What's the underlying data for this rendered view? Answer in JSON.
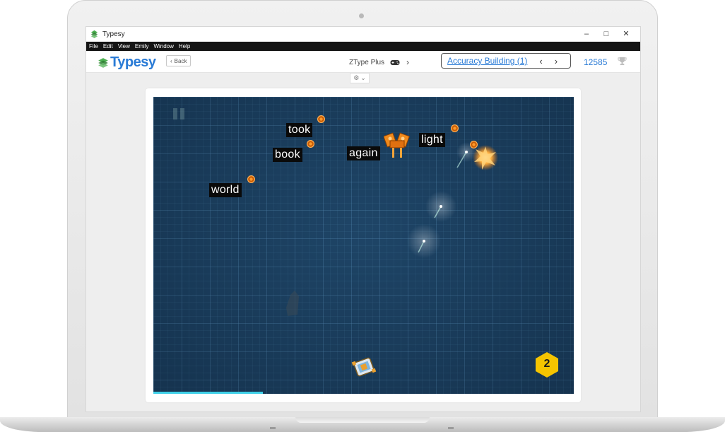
{
  "window": {
    "title": "Typesy",
    "controls": {
      "minimize": "–",
      "maximize": "□",
      "close": "✕"
    }
  },
  "menu": [
    "File",
    "Edit",
    "View",
    "Emily",
    "Window",
    "Help"
  ],
  "toolbar": {
    "logo_text": "Typesy",
    "back_label": "Back",
    "game_name": "ZType Plus",
    "lesson_link": "Accuracy Building (1)",
    "score": "12585"
  },
  "game": {
    "words": [
      "took",
      "book",
      "again",
      "light",
      "world"
    ],
    "wave": "2",
    "progress_fraction": 0.26
  },
  "colors": {
    "accent": "#2a7bd6",
    "game_background": "#1b3e5e",
    "enemy_orange": "#ff9a2a",
    "wave_badge": "#f5c400",
    "progress": "#3fd0e8"
  },
  "icons": [
    "typesy-logo-icon",
    "back-chevron-icon",
    "gamepad-icon",
    "chevron-right-icon",
    "chevron-left-icon",
    "trophy-icon",
    "settings-gear-icon",
    "pause-icon"
  ]
}
